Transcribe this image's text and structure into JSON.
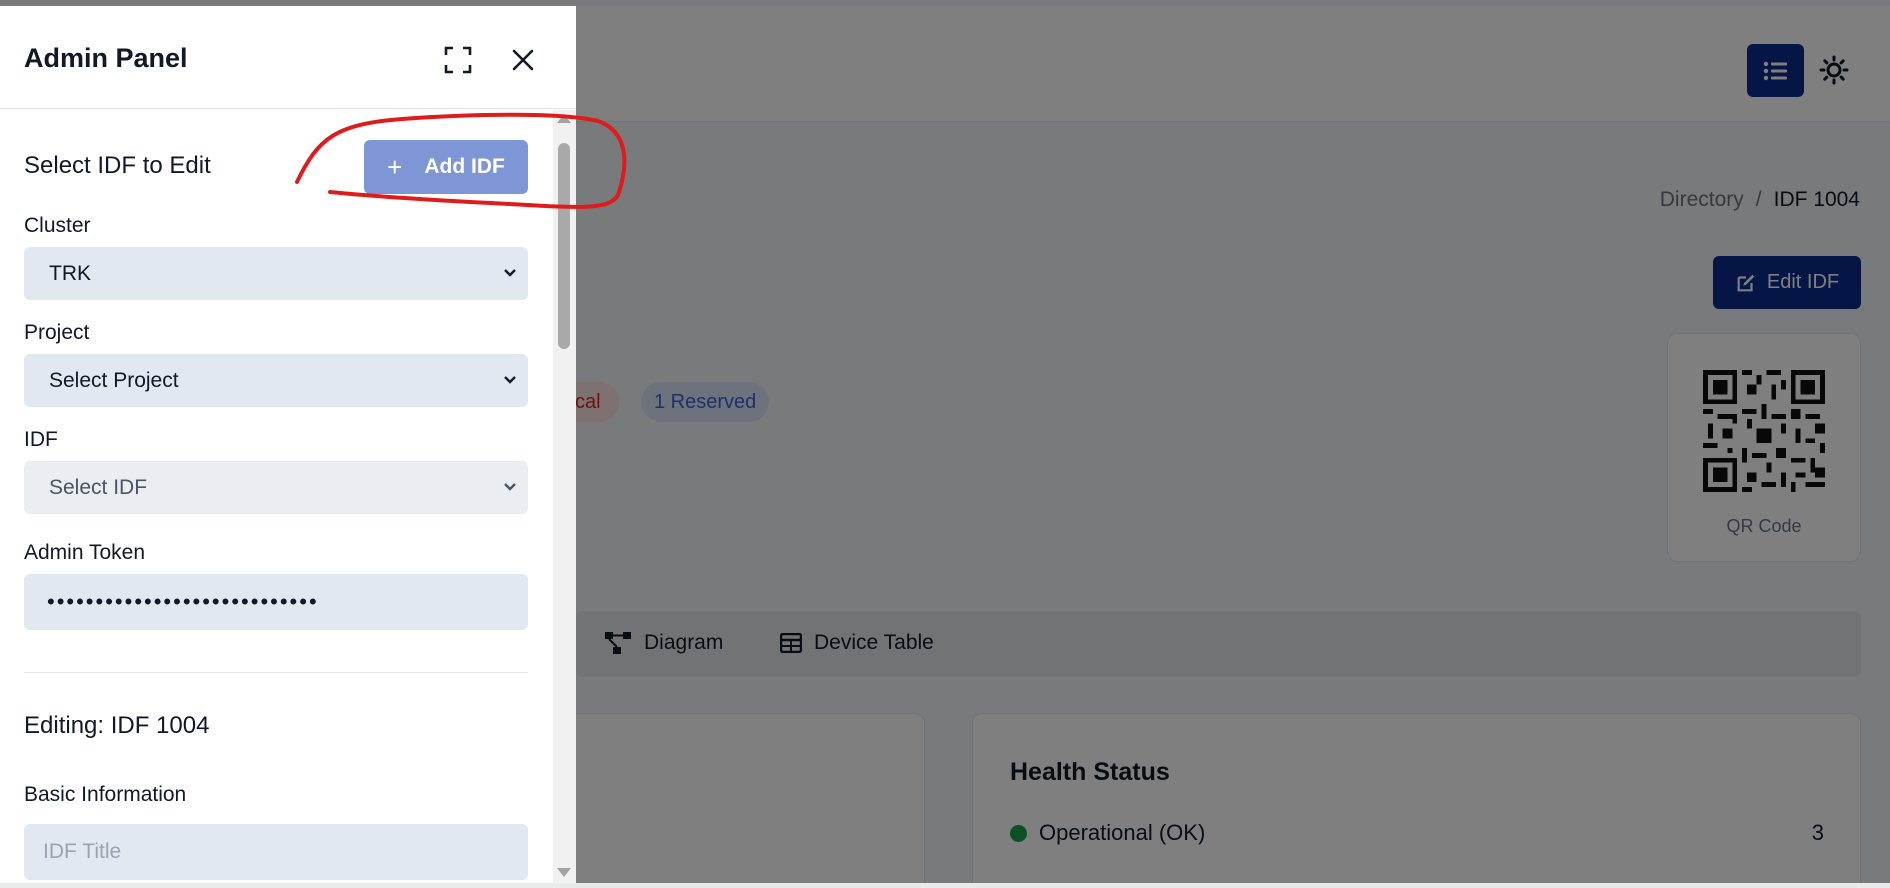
{
  "background": {
    "breadcrumb": {
      "root": "Directory",
      "separator": "/",
      "current": "IDF 1004"
    },
    "edit_button_label": "Edit IDF",
    "badges": {
      "critical_fragment": "cal",
      "reserved": "1 Reserved"
    },
    "qr_label": "QR Code",
    "tabs": [
      {
        "label": "Diagram",
        "icon": "diagram-icon"
      },
      {
        "label": "Device Table",
        "icon": "table-icon"
      }
    ],
    "health": {
      "title": "Health Status",
      "row_label": "Operational (OK)",
      "row_count": "3",
      "dot_color": "#16a34a"
    },
    "colors": {
      "primary": "#0b2a8a"
    }
  },
  "panel": {
    "title": "Admin Panel",
    "section_title": "Select IDF to Edit",
    "add_button_label": "Add IDF",
    "cluster": {
      "label": "Cluster",
      "value": "TRK"
    },
    "project": {
      "label": "Project",
      "value": "Select Project"
    },
    "idf": {
      "label": "IDF",
      "value": "Select IDF"
    },
    "token": {
      "label": "Admin Token",
      "value": "••••••••••••••••••••••••••••"
    },
    "editing_title": "Editing: IDF 1004",
    "basic_info_label": "Basic Information",
    "idf_title_placeholder": "IDF Title",
    "colors": {
      "add_button": "#7f96d6",
      "field_bg": "#e2e8f0"
    }
  },
  "annotation": {
    "color": "#e01b1b",
    "target": "Add IDF"
  }
}
